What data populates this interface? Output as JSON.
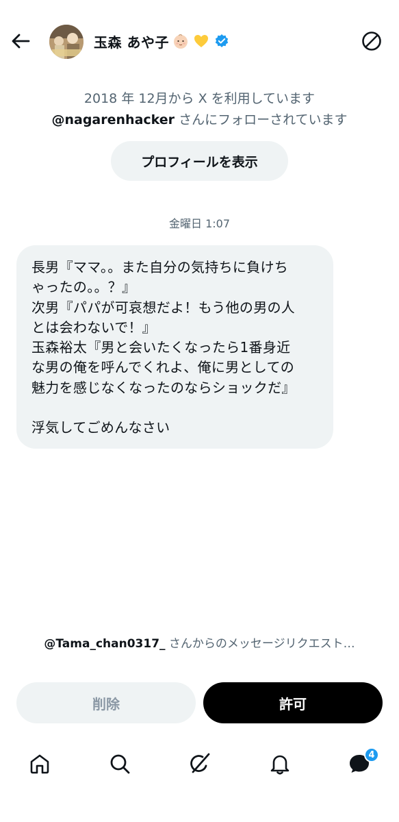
{
  "header": {
    "name": "玉森 あや子",
    "name_emoji_icons": [
      "baby-face-icon",
      "yellow-heart-icon",
      "verified-badge-icon"
    ]
  },
  "profile_info": {
    "joined": "2018 年 12月から X を利用しています",
    "followed_by_handle": "@nagarenhacker",
    "followed_by_suffix": " さんにフォローされています",
    "view_profile_label": "プロフィールを表示"
  },
  "conversation": {
    "timestamp": "金曜日 1:07",
    "message_lines": [
      "長男『ママ。。また自分の気持ちに負けち",
      "ゃったの。。？』",
      "次男『パパが可哀想だよ！もう他の男の人",
      "とは会わないで！』",
      "玉森裕太『男と会いたくなったら1番身近",
      "な男の俺を呼んでくれよ、俺に男としての",
      "魅力を感じなくなったのならショックだ』",
      "",
      "浮気してごめんなさい"
    ]
  },
  "request": {
    "handle": "@Tama_chan0317_",
    "suffix": " さんからのメッセージリクエスト…",
    "delete_label": "削除",
    "allow_label": "許可"
  },
  "nav": {
    "items": [
      "home-icon",
      "search-icon",
      "grok-icon",
      "notifications-icon",
      "messages-icon"
    ],
    "messages_badge": "4"
  },
  "colors": {
    "accent": "#1d9bf0",
    "bubble_bg": "#eff3f4",
    "secondary_text": "#536471",
    "primary_button": "#000000"
  }
}
